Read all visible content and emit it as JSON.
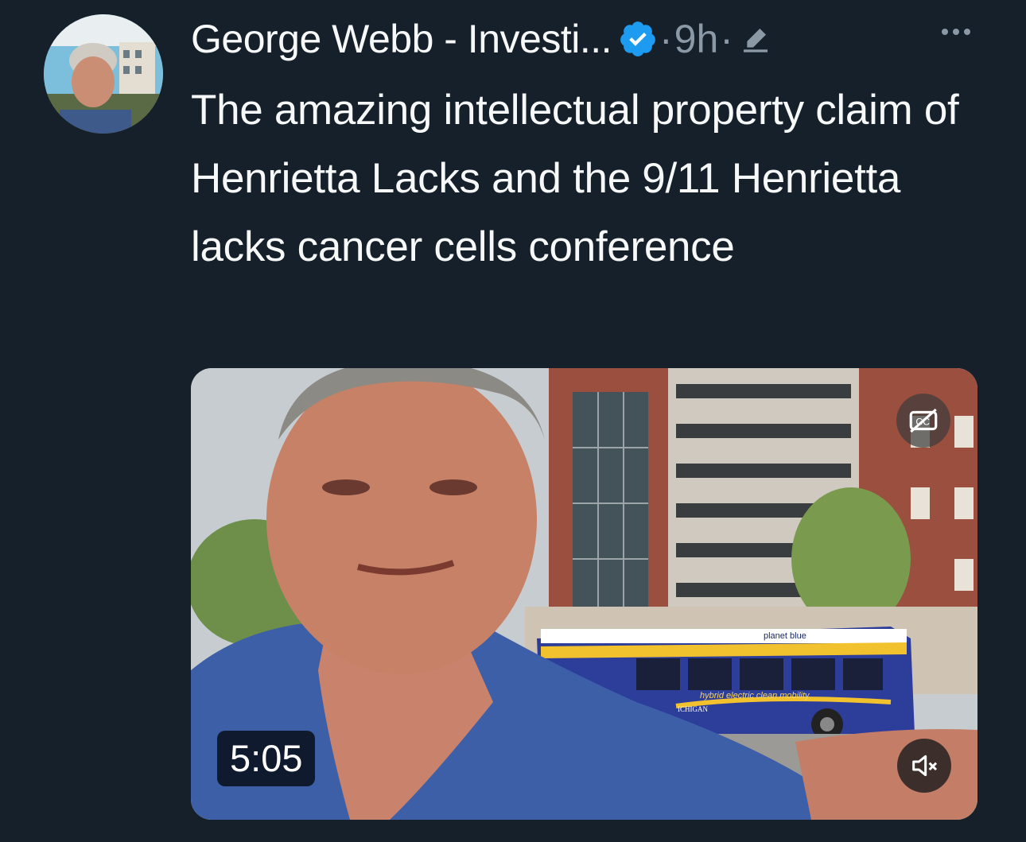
{
  "tweet": {
    "author_name": "George Webb - Investi...",
    "separator": "·",
    "time": "9h",
    "text": "The amazing intellectual property claim of Henrietta Lacks and the 9/11 Henrietta lacks cancer cells conference",
    "verified_color": "#1d9bf0"
  },
  "media": {
    "duration": "5:05",
    "bus_brand": "planet blue",
    "bus_side_text": "hybrid electric clean mobility",
    "bus_lower_text": "ICHIGAN"
  },
  "icons": {
    "verified": "verified-badge-icon",
    "edit": "edited-pencil-icon",
    "more": "more-options-icon",
    "captions": "captions-off-icon",
    "mute": "muted-speaker-icon"
  }
}
